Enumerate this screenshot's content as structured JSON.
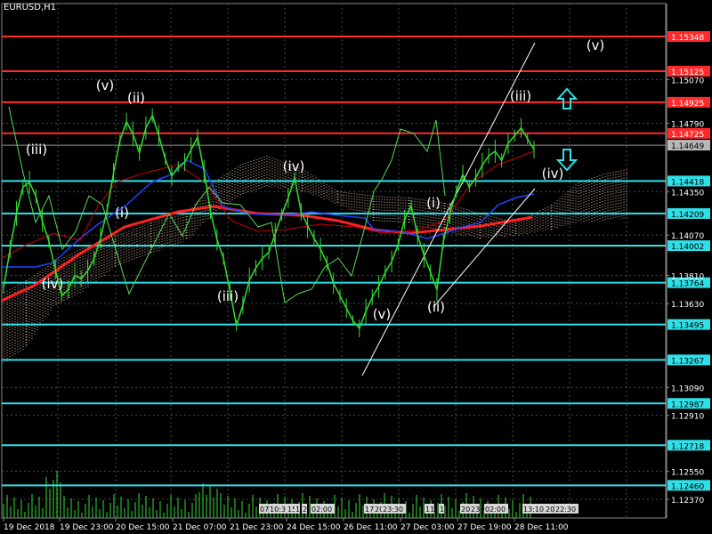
{
  "symbol_label": "EURUSD,H1",
  "colors": {
    "background": "#000000",
    "grid": "#4a4a4a",
    "price_series": "#33dd33",
    "red_level": "#ff2a2a",
    "cyan_level": "#2ee0e8",
    "red_ma": "#ff2020",
    "blue_line": "#2244ff",
    "lagging_line": "#55dd55",
    "kijun_red": "#cc0000",
    "cloud_dots": "#e0b8a0",
    "channel": "#ffffff",
    "wave_label": "#ffffff",
    "arrow": "#2ee0e8",
    "current_price_bg": "#b8b8b8",
    "axis_text": "#ffffff"
  },
  "icons": {
    "up_arrow": "up-arrow-icon",
    "down_arrow": "down-arrow-icon"
  },
  "chart_data": {
    "type": "line",
    "title": "EURUSD,H1",
    "xlabel": "",
    "ylabel": "",
    "ylim": [
      1.1225,
      1.1556
    ],
    "y_ticks": [
      "1.15070",
      "1.14790",
      "1.14350",
      "1.14070",
      "1.13810",
      "1.13630",
      "1.13090",
      "1.12910",
      "1.12550",
      "1.12370"
    ],
    "x_ticks": [
      "19 Dec 2018",
      "19 Dec 23:00",
      "20 Dec 15:00",
      "21 Dec 07:00",
      "21 Dec 23:00",
      "24 Dec 15:00",
      "26 Dec 11:00",
      "27 Dec 03:00",
      "27 Dec 19:00",
      "28 Dec 11:00"
    ],
    "series": [
      {
        "values": [
          1.1373,
          1.1398,
          1.1421,
          1.1438,
          1.1441,
          1.1432,
          1.1416,
          1.1403,
          1.1385,
          1.1368,
          1.1372,
          1.1381,
          1.1379,
          1.1384,
          1.1392,
          1.1405,
          1.1423,
          1.1447,
          1.1468,
          1.148,
          1.1472,
          1.146,
          1.1476,
          1.1484,
          1.1471,
          1.1456,
          1.1445,
          1.1451,
          1.1454,
          1.1462,
          1.147,
          1.1448,
          1.1422,
          1.1404,
          1.1392,
          1.1371,
          1.1349,
          1.1362,
          1.1378,
          1.1386,
          1.1392,
          1.1396,
          1.1408,
          1.142,
          1.1431,
          1.1444,
          1.1422,
          1.1413,
          1.1405,
          1.1398,
          1.1389,
          1.1376,
          1.1368,
          1.136,
          1.1352,
          1.1347,
          1.1358,
          1.1367,
          1.1374,
          1.1383,
          1.139,
          1.1401,
          1.1417,
          1.1426,
          1.1407,
          1.1394,
          1.1383,
          1.1372,
          1.1403,
          1.1421,
          1.1435,
          1.1446,
          1.1438,
          1.1444,
          1.1452,
          1.1458,
          1.1461,
          1.1455,
          1.1466,
          1.1471,
          1.1476,
          1.1469,
          1.1462
        ]
      }
    ],
    "horizontal_levels": [
      {
        "label": "1.15348",
        "value": 1.15348,
        "kind": "red"
      },
      {
        "label": "1.15125",
        "value": 1.15125,
        "kind": "red"
      },
      {
        "label": "1.14925",
        "value": 1.14925,
        "kind": "red"
      },
      {
        "label": "1.14725",
        "value": 1.14725,
        "kind": "red"
      },
      {
        "label": "1.14418",
        "value": 1.14418,
        "kind": "cyan"
      },
      {
        "label": "1.14209",
        "value": 1.14209,
        "kind": "cyan"
      },
      {
        "label": "1.14002",
        "value": 1.14002,
        "kind": "cyan"
      },
      {
        "label": "1.13764",
        "value": 1.13764,
        "kind": "cyan"
      },
      {
        "label": "1.13495",
        "value": 1.13495,
        "kind": "cyan"
      },
      {
        "label": "1.13267",
        "value": 1.13267,
        "kind": "cyan"
      },
      {
        "label": "1.12987",
        "value": 1.12987,
        "kind": "cyan"
      },
      {
        "label": "1.12718",
        "value": 1.12718,
        "kind": "cyan"
      },
      {
        "label": "1.12460",
        "value": 1.1246,
        "kind": "cyan"
      }
    ],
    "current_price": "1.14649",
    "wave_labels": [
      "(iii)",
      "(iv)",
      "(v)",
      "(i)",
      "(ii)",
      "(iii)",
      "(iv)",
      "(v)",
      "(i)",
      "(ii)",
      "(iii)",
      "(iv)",
      "(v)"
    ],
    "time_markers": [
      "07",
      "10:3",
      "15",
      "1",
      "2",
      "02:00",
      "17",
      "20",
      "23:30",
      "11",
      "1",
      "20",
      "23",
      "02:00",
      "13:10",
      "20",
      "22:30"
    ],
    "grid": true
  }
}
